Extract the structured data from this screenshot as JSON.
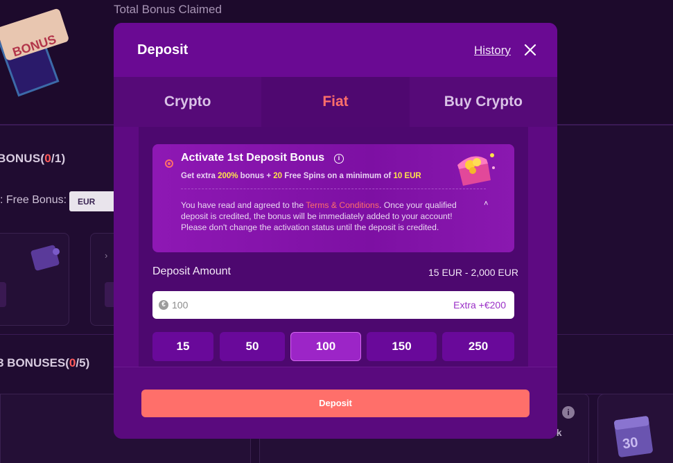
{
  "background": {
    "total_bonus_claimed": "Total Bonus Claimed",
    "bonus_section_1": {
      "prefix": "BONUS(",
      "count": "0",
      "suffix": "/1)"
    },
    "free_bonus_label": ": Free Bonus:",
    "currency": "EUR",
    "bonus_section_2": {
      "prefix": "3 BONUSES(",
      "count": "0",
      "suffix": "/5)"
    },
    "card_text_partial": "ck",
    "calendar_number": "30"
  },
  "modal": {
    "title": "Deposit",
    "history_label": "History",
    "tabs": [
      {
        "label": "Crypto",
        "active": false
      },
      {
        "label": "Fiat",
        "active": true
      },
      {
        "label": "Buy Crypto",
        "active": false
      }
    ],
    "bonus": {
      "title": "Activate 1st Deposit Bonus",
      "sub_1": "Get extra ",
      "percent": "200%",
      "sub_2": " bonus + ",
      "spins_count": "20",
      "sub_3": " Free Spins on a minimum of ",
      "minimum": "10 EUR",
      "desc_1": "You have read and agreed to the ",
      "terms": "Terms & Conditions",
      "desc_2": ". Once your qualified deposit is credited, the bonus will be immediately added to your account! Please don't change the activation status until the deposit is credited."
    },
    "amount_label": "Deposit Amount",
    "amount_range": "15 EUR - 2,000 EUR",
    "input_value": "100",
    "extra_label": "Extra +€200",
    "presets": [
      "15",
      "50",
      "100",
      "150",
      "250"
    ],
    "selected_preset": "100",
    "deposit_button": "Deposit"
  },
  "colors": {
    "accent": "#ff6f6a",
    "modal": "#5e0a82",
    "highlight": "#ffe44a"
  }
}
